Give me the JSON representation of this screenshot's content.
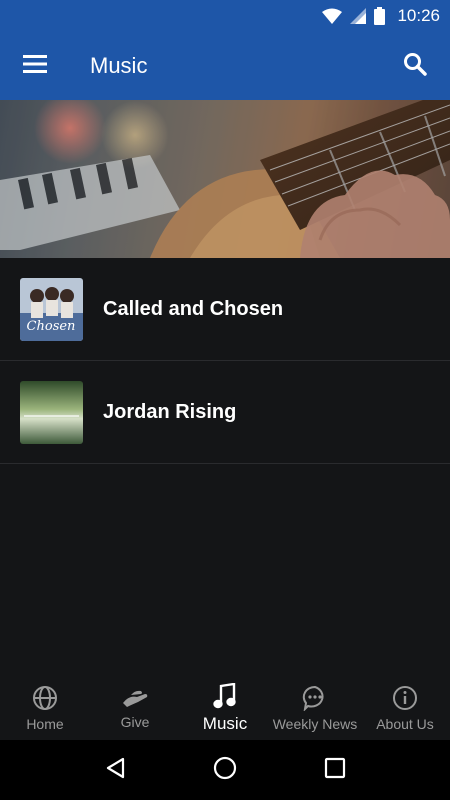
{
  "status_bar": {
    "time": "10:26",
    "icons": [
      "wifi-icon",
      "cell-signal-icon",
      "battery-icon"
    ]
  },
  "app_bar": {
    "title": "Music",
    "menu_icon": "hamburger-menu-icon",
    "search_icon": "search-icon",
    "color": "#1e56a8"
  },
  "hero": {
    "description_icon": "guitar-photo"
  },
  "albums": [
    {
      "title": "Called and Chosen",
      "thumb_icon": "album-cover-called-and-chosen"
    },
    {
      "title": "Jordan Rising",
      "thumb_icon": "album-cover-jordan-rising"
    }
  ],
  "bottom_nav": {
    "items": [
      {
        "label": "Home",
        "icon": "globe-icon",
        "active": false
      },
      {
        "label": "Give",
        "icon": "hand-icon",
        "active": false
      },
      {
        "label": "Music",
        "icon": "music-note-icon",
        "active": true
      },
      {
        "label": "Weekly News",
        "icon": "chat-bubble-icon",
        "active": false
      },
      {
        "label": "About Us",
        "icon": "info-icon",
        "active": false
      }
    ]
  },
  "system_nav": {
    "icons": [
      "back-icon",
      "home-circle-icon",
      "recents-icon"
    ]
  },
  "colors": {
    "primary": "#1e56a8",
    "list_background": "#141517",
    "inactive_nav": "#9a9a9a"
  }
}
